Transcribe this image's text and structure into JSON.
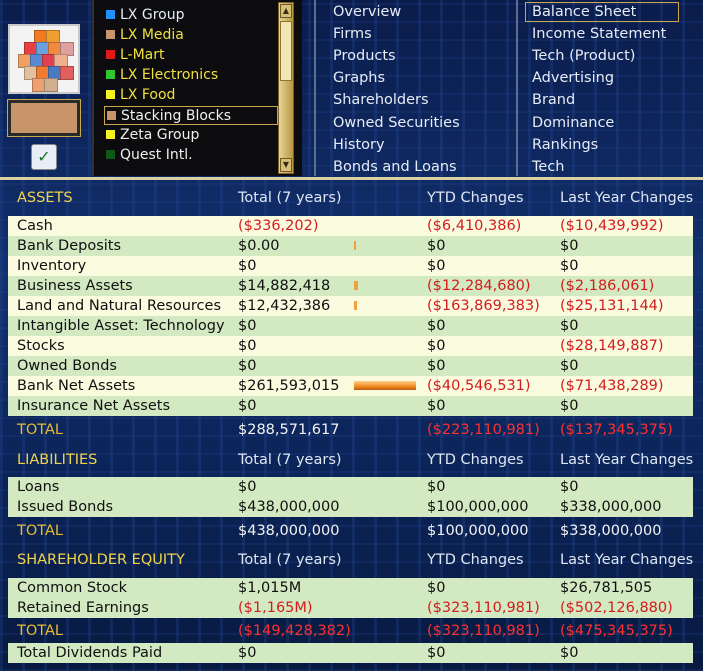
{
  "firms": [
    {
      "name": "LX Group",
      "color": "#1e90ff"
    },
    {
      "name": "LX Media",
      "color": "#c8946a"
    },
    {
      "name": "L-Mart",
      "color": "#e01818"
    },
    {
      "name": "LX Electronics",
      "color": "#2ec82e"
    },
    {
      "name": "LX Food",
      "color": "#f5f020"
    },
    {
      "name": "Stacking Blocks",
      "color": "#c8946a",
      "selected": true
    },
    {
      "name": "Zeta Group",
      "color": "#f5f020"
    },
    {
      "name": "Quest Intl.",
      "color": "#0e5a14"
    }
  ],
  "firm_text_colors": [
    "#e6ecf6",
    "#f0e040",
    "#f0e040",
    "#f0e040",
    "#f0e040",
    "#f0f0f0",
    "#f0f0f0",
    "#f0f0f0"
  ],
  "menu_left": [
    "Overview",
    "Firms",
    "Products",
    "Graphs",
    "Shareholders",
    "Owned Securities",
    "History",
    "Bonds and Loans"
  ],
  "menu_right": [
    "Balance Sheet",
    "Income Statement",
    "Tech (Product)",
    "Advertising",
    "Brand",
    "Dominance",
    "Rankings",
    "Tech"
  ],
  "columns": {
    "total": "Total (7 years)",
    "ytd": "YTD Changes",
    "last": "Last Year Changes"
  },
  "assets": {
    "title": "ASSETS",
    "rows": [
      {
        "label": "Cash",
        "total": "($336,202)",
        "ytd": "($6,410,386)",
        "last": "($10,439,992)",
        "bar": 0
      },
      {
        "label": "Bank Deposits",
        "total": "$0.00",
        "ytd": "$0",
        "last": "$0",
        "bar": 0.002
      },
      {
        "label": "Inventory",
        "total": "$0",
        "ytd": "$0",
        "last": "$0",
        "bar": 0
      },
      {
        "label": "Business Assets",
        "total": "$14,882,418",
        "ytd": "($12,284,680)",
        "last": "($2,186,061)",
        "bar": 0.057
      },
      {
        "label": "Land and Natural Resources",
        "total": "$12,432,386",
        "ytd": "($163,869,383)",
        "last": "($25,131,144)",
        "bar": 0.048
      },
      {
        "label": "Intangible Asset: Technology",
        "total": "$0",
        "ytd": "$0",
        "last": "$0",
        "bar": 0
      },
      {
        "label": "Stocks",
        "total": "$0",
        "ytd": "$0",
        "last": "($28,149,887)",
        "bar": 0
      },
      {
        "label": "Owned Bonds",
        "total": "$0",
        "ytd": "$0",
        "last": "$0",
        "bar": 0
      },
      {
        "label": "Bank Net Assets",
        "total": "$261,593,015",
        "ytd": "($40,546,531)",
        "last": "($71,438,289)",
        "bar": 1
      },
      {
        "label": "Insurance Net Assets",
        "total": "$0",
        "ytd": "$0",
        "last": "$0",
        "bar": 0
      }
    ],
    "total": {
      "label": "TOTAL",
      "total": "$288,571,617",
      "ytd": "($223,110,981)",
      "last": "($137,345,375)"
    }
  },
  "liabilities": {
    "title": "LIABILITIES",
    "rows": [
      {
        "label": "Loans",
        "total": "$0",
        "ytd": "$0",
        "last": "$0"
      },
      {
        "label": "Issued Bonds",
        "total": "$438,000,000",
        "ytd": "$100,000,000",
        "last": "$338,000,000"
      }
    ],
    "total": {
      "label": "TOTAL",
      "total": "$438,000,000",
      "ytd": "$100,000,000",
      "last": "$338,000,000"
    }
  },
  "equity": {
    "title": "SHAREHOLDER EQUITY",
    "rows": [
      {
        "label": "Common Stock",
        "total": "$1,015M",
        "ytd": "$0",
        "last": "$26,781,505"
      },
      {
        "label": "Retained Earnings",
        "total": "($1,165M)",
        "ytd": "($323,110,981)",
        "last": "($502,126,880)"
      }
    ],
    "total": {
      "label": "TOTAL",
      "total": "($149,428,382)",
      "ytd": "($323,110,981)",
      "last": "($475,345,375)"
    },
    "dividends": {
      "label": "Total Dividends Paid",
      "total": "$0",
      "ytd": "$0",
      "last": "$0"
    }
  },
  "colors": {
    "negative": "#d41c1c",
    "accent": "#e8bb2c",
    "header": "#f2d44a"
  }
}
